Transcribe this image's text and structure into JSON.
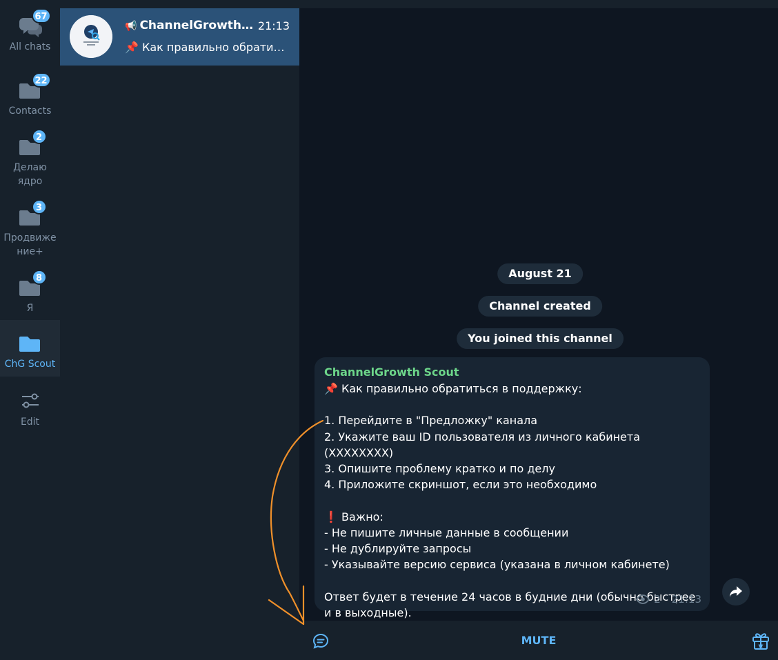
{
  "folders": [
    {
      "label": "All chats",
      "badge": "67",
      "icon": "chats-icon"
    },
    {
      "label": "Contacts",
      "badge": "22",
      "icon": "folder-icon"
    },
    {
      "label": "Делаю ядро",
      "badge": "2",
      "icon": "folder-icon"
    },
    {
      "label": "Продвиже ние+",
      "badge": "3",
      "icon": "folder-icon"
    },
    {
      "label": "Я",
      "badge": "8",
      "icon": "folder-icon"
    },
    {
      "label": "ChG Scout",
      "badge": "",
      "icon": "folder-icon",
      "active": true
    },
    {
      "label": "Edit",
      "icon": "edit-sliders-icon"
    }
  ],
  "chat_list": {
    "items": [
      {
        "title": "ChannelGrowth Sc...",
        "type_icon": "megaphone-icon",
        "time": "21:13",
        "preview": "📌 Как правильно обратит..."
      }
    ]
  },
  "chat": {
    "service": [
      "August 21",
      "Channel created",
      "You joined this channel"
    ],
    "message": {
      "author": "ChannelGrowth Scout",
      "text": "📌 Как правильно обратиться в поддержку:\n\n1. Перейдите в \"Предложку\" канала\n2. Укажите ваш ID пользователя из личного кабинета (XXXXXXXX)\n3. Опишите проблему кратко и по делу\n4. Приложите скриншот, если это необходимо\n\n❗ Важно:\n- Не пишите личные данные в сообщении\n- Не дублируйте запросы\n- Указывайте версию сервиса (указана в личном кабинете)\n\nОтвет будет в течение 24 часов в будние дни (обычно быстрее и в выходные).",
      "views": "2",
      "time": "21:13"
    },
    "bottom_bar": {
      "mute_label": "MUTE"
    }
  },
  "colors": {
    "sidebar_bg": "#17212b",
    "chat_bg": "#0e1621",
    "accent": "#5eb5f7",
    "selected_chat": "#2b5278",
    "bubble_bg": "#182533",
    "author_name": "#6dd68a",
    "annotation_arrow": "#f0902a"
  }
}
